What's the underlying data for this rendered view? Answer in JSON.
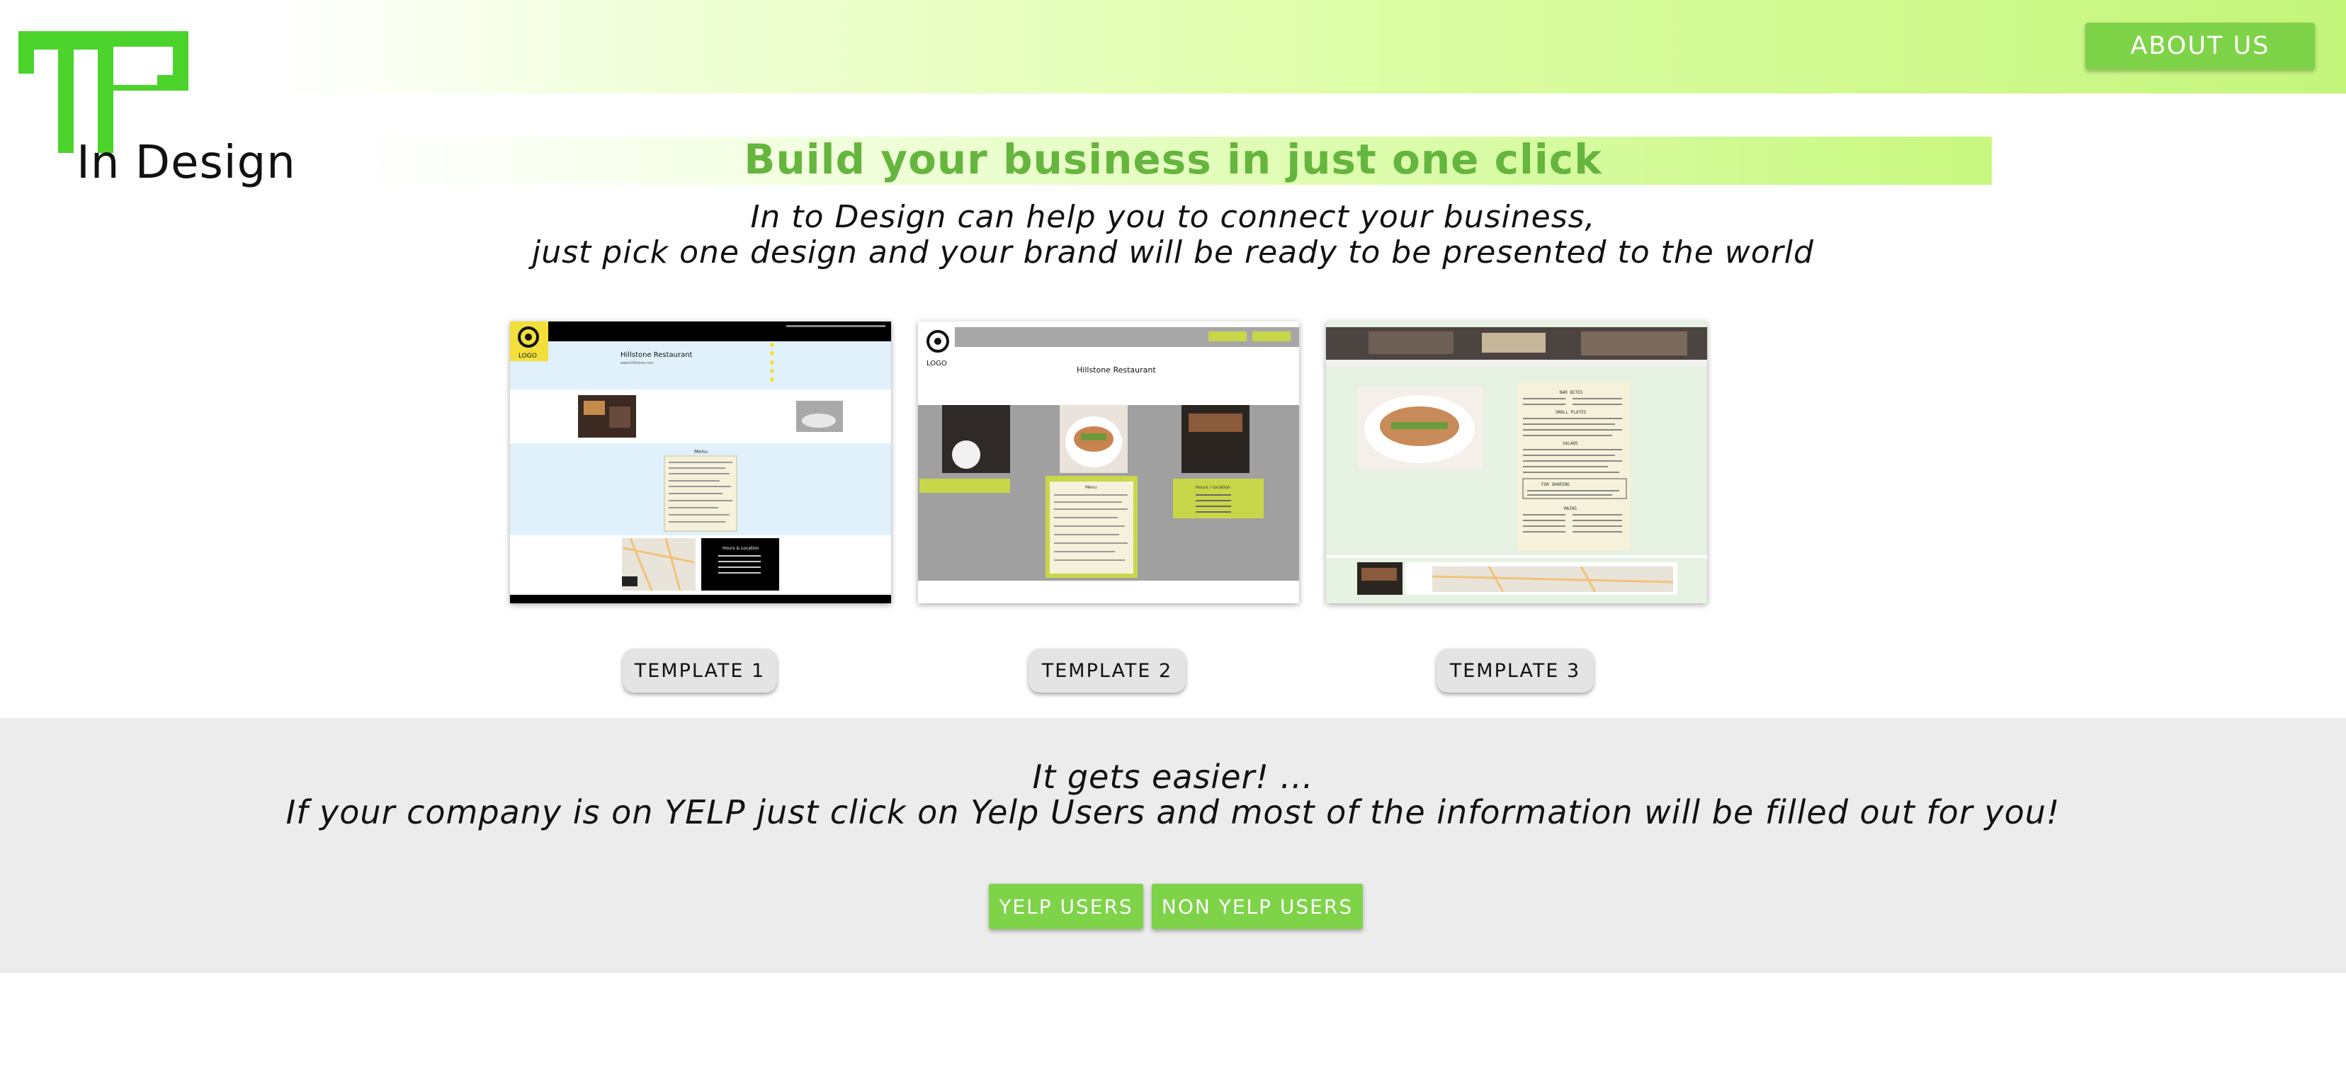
{
  "header": {
    "logo_text": "In Design",
    "about_label": "ABOUT US"
  },
  "hero": {
    "headline": "Build your business in just one click",
    "subtitle_line1": "In to Design can help you to connect your business,",
    "subtitle_line2": "just pick one design and your brand will be ready to be presented to the world"
  },
  "templates": [
    {
      "label": "TEMPLATE 1",
      "preview": {
        "logo": "LOGO",
        "title": "Hillstone Restaurant",
        "tagline": "www.hillstone.com",
        "menu_heading": "Menu",
        "hours_heading": "Hours & Location"
      }
    },
    {
      "label": "TEMPLATE 2",
      "preview": {
        "logo": "LOGO",
        "title": "Hillstone Restaurant",
        "menu_heading": "Menu",
        "hours_heading": "Hours / Location"
      }
    },
    {
      "label": "TEMPLATE 3",
      "preview": {
        "menu_title": "BAR BITES",
        "section_small_plates": "SMALL PLATES",
        "section_salads": "SALADS",
        "section_share": "FOR SHARING",
        "section_mains": "MAINS"
      }
    }
  ],
  "yelp": {
    "line1": "It gets easier! ...",
    "line2": "If your company is on YELP just click on Yelp Users and most of the information will be filled out for you!",
    "yelp_label": "YELP USERS",
    "nonyelp_label": "NON YELP USERS"
  },
  "colors": {
    "brand_green": "#7ed348",
    "headline_green": "#66b53e",
    "logo_green": "#4cd42c",
    "band_grey": "#ececec"
  },
  "icons": {
    "logo": "in-design-logo-mark"
  }
}
